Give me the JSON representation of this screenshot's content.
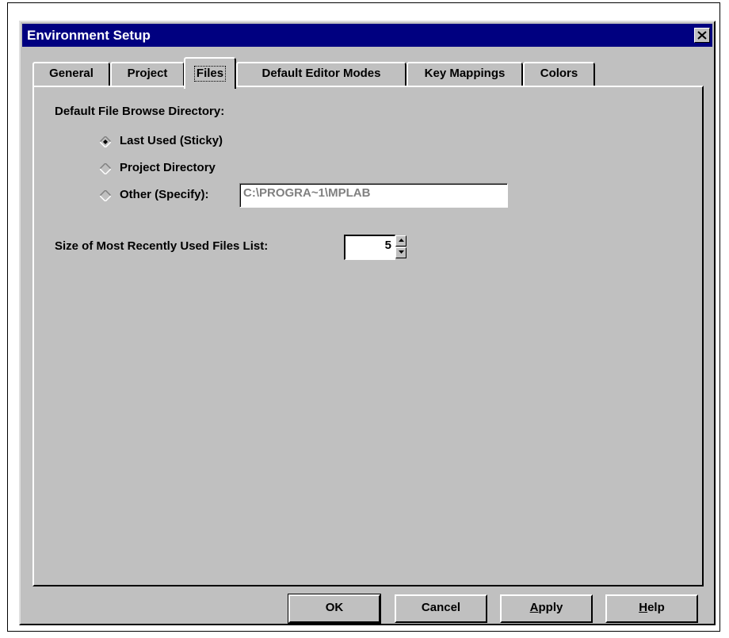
{
  "window": {
    "title": "Environment Setup"
  },
  "tabs": [
    {
      "label": "General"
    },
    {
      "label": "Project"
    },
    {
      "label": "Files"
    },
    {
      "label": "Default Editor Modes"
    },
    {
      "label": "Key Mappings"
    },
    {
      "label": "Colors"
    }
  ],
  "active_tab": "Files",
  "files": {
    "browse_label": "Default File Browse Directory:",
    "options": [
      {
        "label": "Last Used (Sticky)",
        "selected": true
      },
      {
        "label": "Project Directory",
        "selected": false
      },
      {
        "label": "Other (Specify):",
        "selected": false
      }
    ],
    "other_path": "C:\\PROGRA~1\\MPLAB",
    "mru_label": "Size of Most Recently Used Files List:",
    "mru_size": "5"
  },
  "buttons": {
    "ok_label": "OK",
    "cancel_label": "Cancel",
    "apply_prefix": "A",
    "apply_rest": "pply",
    "help_prefix": "H",
    "help_rest": "elp"
  },
  "colors": {
    "titlebar": "#000080",
    "face": "#c0c0c0",
    "disabled_text": "#808080"
  }
}
